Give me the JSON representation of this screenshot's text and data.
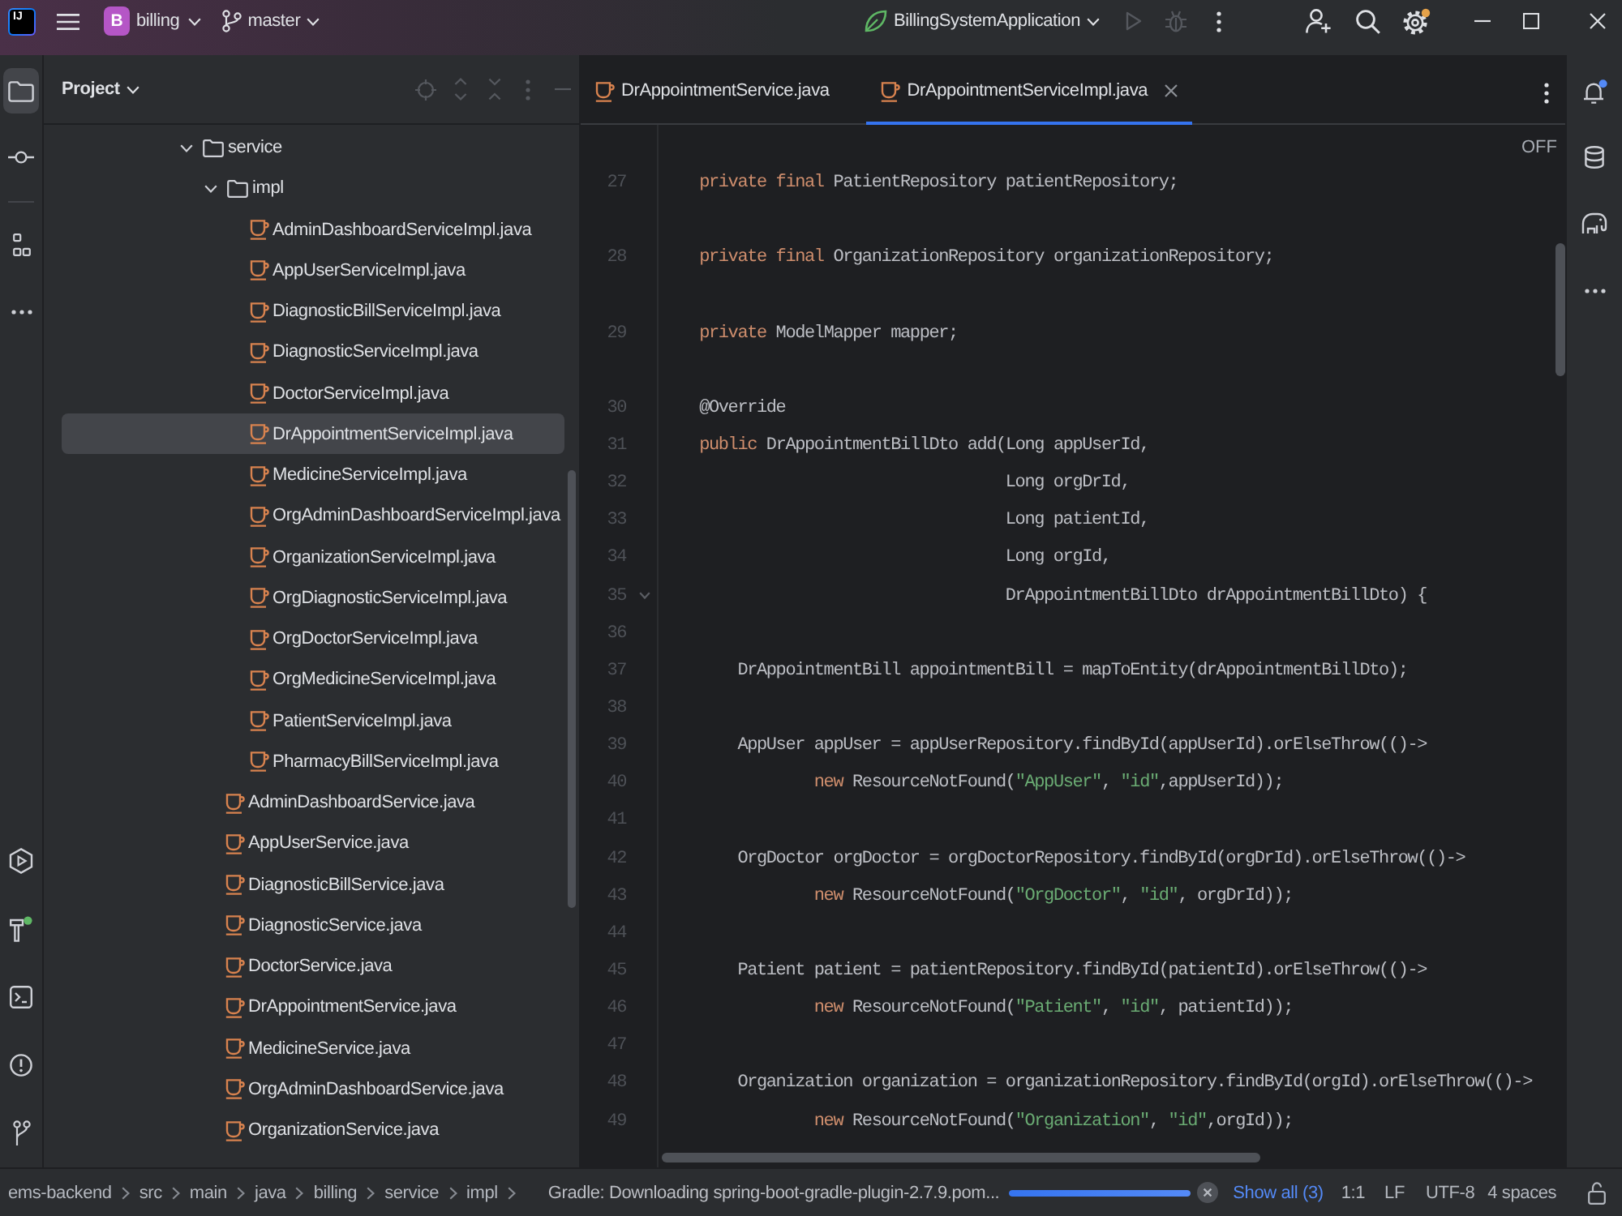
{
  "title_bar": {
    "logo": "IJ",
    "project_badge": "B",
    "project": "billing",
    "branch": "master",
    "run_configuration": "BillingSystemApplication",
    "run_disabled": true,
    "debug_disabled": true
  },
  "tool_strip": {
    "top": [
      {
        "kind": "project",
        "selected": true
      },
      {
        "kind": "commit",
        "selected": false
      },
      {
        "kind": "structure",
        "selected": false
      },
      {
        "kind": "more",
        "selected": false
      }
    ],
    "bottom": [
      {
        "kind": "services",
        "selected": false
      },
      {
        "kind": "build",
        "selected": false
      },
      {
        "kind": "terminal",
        "selected": false
      },
      {
        "kind": "problems",
        "selected": false
      },
      {
        "kind": "git",
        "selected": false
      }
    ]
  },
  "project_panel": {
    "title": "Project",
    "tree": [
      {
        "kind": "folder",
        "label": "service",
        "expanded": true,
        "selected": false,
        "children": [
          {
            "kind": "folder",
            "label": "impl",
            "expanded": true,
            "selected": false,
            "children": [
              {
                "kind": "java",
                "label": "AdminDashboardServiceImpl.java",
                "selected": false
              },
              {
                "kind": "java",
                "label": "AppUserServiceImpl.java",
                "selected": false
              },
              {
                "kind": "java",
                "label": "DiagnosticBillServiceImpl.java",
                "selected": false
              },
              {
                "kind": "java",
                "label": "DiagnosticServiceImpl.java",
                "selected": false
              },
              {
                "kind": "java",
                "label": "DoctorServiceImpl.java",
                "selected": false
              },
              {
                "kind": "java",
                "label": "DrAppointmentServiceImpl.java",
                "selected": true
              },
              {
                "kind": "java",
                "label": "MedicineServiceImpl.java",
                "selected": false
              },
              {
                "kind": "java",
                "label": "OrgAdminDashboardServiceImpl.java",
                "selected": false
              },
              {
                "kind": "java",
                "label": "OrganizationServiceImpl.java",
                "selected": false
              },
              {
                "kind": "java",
                "label": "OrgDiagnosticServiceImpl.java",
                "selected": false
              },
              {
                "kind": "java",
                "label": "OrgDoctorServiceImpl.java",
                "selected": false
              },
              {
                "kind": "java",
                "label": "OrgMedicineServiceImpl.java",
                "selected": false
              },
              {
                "kind": "java",
                "label": "PatientServiceImpl.java",
                "selected": false
              },
              {
                "kind": "java",
                "label": "PharmacyBillServiceImpl.java",
                "selected": false
              }
            ]
          },
          {
            "kind": "java",
            "label": "AdminDashboardService.java",
            "selected": false
          },
          {
            "kind": "java",
            "label": "AppUserService.java",
            "selected": false
          },
          {
            "kind": "java",
            "label": "DiagnosticBillService.java",
            "selected": false
          },
          {
            "kind": "java",
            "label": "DiagnosticService.java",
            "selected": false
          },
          {
            "kind": "java",
            "label": "DoctorService.java",
            "selected": false
          },
          {
            "kind": "java",
            "label": "DrAppointmentService.java",
            "selected": false
          },
          {
            "kind": "java",
            "label": "MedicineService.java",
            "selected": false
          },
          {
            "kind": "java",
            "label": "OrgAdminDashboardService.java",
            "selected": false
          },
          {
            "kind": "java",
            "label": "OrganizationService.java",
            "selected": false
          }
        ]
      }
    ]
  },
  "editor": {
    "tabs": [
      {
        "label": "DrAppointmentService.java",
        "selected": false,
        "closable": false
      },
      {
        "label": "DrAppointmentServiceImpl.java",
        "selected": true,
        "closable": true
      }
    ],
    "reader_mode": "OFF",
    "lines": [
      {
        "number": "27",
        "gap_above": true,
        "fold": false,
        "tokens": [
          {
            "kind": "keyword",
            "text": "    private final"
          },
          {
            "kind": "plain",
            "text": " PatientRepository patientRepository;"
          }
        ]
      },
      {
        "number": "28",
        "gap_above": true,
        "fold": false,
        "tokens": [
          {
            "kind": "keyword",
            "text": "    private final"
          },
          {
            "kind": "plain",
            "text": " OrganizationRepository organizationRepository;"
          }
        ]
      },
      {
        "number": "29",
        "gap_above": true,
        "fold": false,
        "tokens": [
          {
            "kind": "keyword",
            "text": "    private"
          },
          {
            "kind": "plain",
            "text": " ModelMapper mapper;"
          }
        ]
      },
      {
        "number": "30",
        "gap_above": true,
        "fold": false,
        "tokens": [
          {
            "kind": "plain",
            "text": "    @Override"
          }
        ]
      },
      {
        "number": "31",
        "gap_above": false,
        "fold": false,
        "tokens": [
          {
            "kind": "keyword",
            "text": "    public"
          },
          {
            "kind": "plain",
            "text": " DrAppointmentBillDto add(Long appUserId,"
          }
        ]
      },
      {
        "number": "32",
        "gap_above": false,
        "fold": false,
        "tokens": [
          {
            "kind": "plain",
            "text": "                                    Long orgDrId,"
          }
        ]
      },
      {
        "number": "33",
        "gap_above": false,
        "fold": false,
        "tokens": [
          {
            "kind": "plain",
            "text": "                                    Long patientId,"
          }
        ]
      },
      {
        "number": "34",
        "gap_above": false,
        "fold": false,
        "tokens": [
          {
            "kind": "plain",
            "text": "                                    Long orgId,"
          }
        ]
      },
      {
        "number": "35",
        "gap_above": false,
        "fold": true,
        "tokens": [
          {
            "kind": "plain",
            "text": "                                    DrAppointmentBillDto drAppointmentBillDto) {"
          }
        ]
      },
      {
        "number": "36",
        "gap_above": false,
        "fold": false
      },
      {
        "number": "37",
        "gap_above": false,
        "fold": false,
        "tokens": [
          {
            "kind": "plain",
            "text": "        DrAppointmentBill appointmentBill = mapToEntity(drAppointmentBillDto);"
          }
        ]
      },
      {
        "number": "38",
        "gap_above": false,
        "fold": false
      },
      {
        "number": "39",
        "gap_above": false,
        "fold": false,
        "tokens": [
          {
            "kind": "plain",
            "text": "        AppUser appUser = appUserRepository.findById(appUserId).orElseThrow(()->"
          }
        ]
      },
      {
        "number": "40",
        "gap_above": false,
        "fold": false,
        "tokens": [
          {
            "kind": "keyword",
            "text": "                new"
          },
          {
            "kind": "plain",
            "text": " ResourceNotFound("
          },
          {
            "kind": "string",
            "text": "\"AppUser\""
          },
          {
            "kind": "plain",
            "text": ", "
          },
          {
            "kind": "string",
            "text": "\"id\""
          },
          {
            "kind": "plain",
            "text": ",appUserId));"
          }
        ]
      },
      {
        "number": "41",
        "gap_above": false,
        "fold": false
      },
      {
        "number": "42",
        "gap_above": false,
        "fold": false,
        "tokens": [
          {
            "kind": "plain",
            "text": "        OrgDoctor orgDoctor = orgDoctorRepository.findById(orgDrId).orElseThrow(()->"
          }
        ]
      },
      {
        "number": "43",
        "gap_above": false,
        "fold": false,
        "tokens": [
          {
            "kind": "keyword",
            "text": "                new"
          },
          {
            "kind": "plain",
            "text": " ResourceNotFound("
          },
          {
            "kind": "string",
            "text": "\"OrgDoctor\""
          },
          {
            "kind": "plain",
            "text": ", "
          },
          {
            "kind": "string",
            "text": "\"id\""
          },
          {
            "kind": "plain",
            "text": ", orgDrId));"
          }
        ]
      },
      {
        "number": "44",
        "gap_above": false,
        "fold": false
      },
      {
        "number": "45",
        "gap_above": false,
        "fold": false,
        "tokens": [
          {
            "kind": "plain",
            "text": "        Patient patient = patientRepository.findById(patientId).orElseThrow(()->"
          }
        ]
      },
      {
        "number": "46",
        "gap_above": false,
        "fold": false,
        "tokens": [
          {
            "kind": "keyword",
            "text": "                new"
          },
          {
            "kind": "plain",
            "text": " ResourceNotFound("
          },
          {
            "kind": "string",
            "text": "\"Patient\""
          },
          {
            "kind": "plain",
            "text": ", "
          },
          {
            "kind": "string",
            "text": "\"id\""
          },
          {
            "kind": "plain",
            "text": ", patientId));"
          }
        ]
      },
      {
        "number": "47",
        "gap_above": false,
        "fold": false
      },
      {
        "number": "48",
        "gap_above": false,
        "fold": false,
        "tokens": [
          {
            "kind": "plain",
            "text": "        Organization organization = organizationRepository.findById(orgId).orElseThrow(()->"
          }
        ]
      },
      {
        "number": "49",
        "gap_above": false,
        "fold": false,
        "tokens": [
          {
            "kind": "keyword",
            "text": "                new"
          },
          {
            "kind": "plain",
            "text": " ResourceNotFound("
          },
          {
            "kind": "string",
            "text": "\"Organization\""
          },
          {
            "kind": "plain",
            "text": ", "
          },
          {
            "kind": "string",
            "text": "\"id\""
          },
          {
            "kind": "plain",
            "text": ",orgId));"
          }
        ]
      }
    ]
  },
  "right_strip": [
    {
      "kind": "notifications",
      "selected": false
    },
    {
      "kind": "database",
      "selected": false
    },
    {
      "kind": "gradle",
      "selected": false
    },
    {
      "kind": "more",
      "selected": false
    }
  ],
  "status_bar": {
    "breadcrumbs": [
      "ems-backend",
      "src",
      "main",
      "java",
      "billing",
      "service",
      "impl"
    ],
    "task": "Gradle: Downloading spring-boot-gradle-plugin-2.7.9.pom...",
    "progress": {
      "level": 1
    },
    "show_all": "Show all (3)",
    "position": "1:1",
    "line_separator": "LF",
    "encoding": "UTF-8",
    "indent": "4 spaces"
  }
}
